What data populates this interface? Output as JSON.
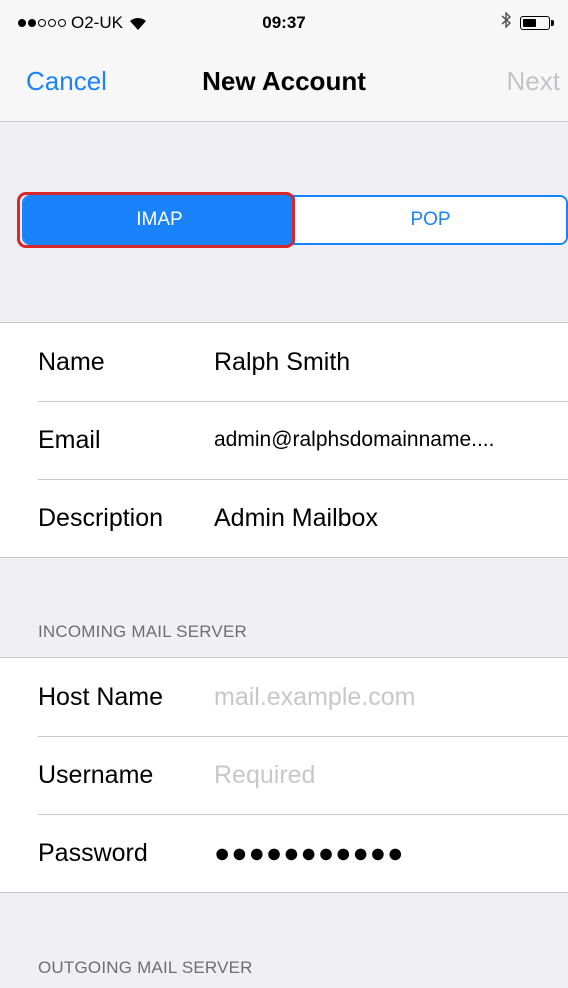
{
  "status_bar": {
    "carrier": "O2-UK",
    "signal_bars_filled": 2,
    "signal_bars_total": 5,
    "time": "09:37",
    "battery_level": 0.55,
    "icons": [
      "wifi-icon",
      "bluetooth-icon",
      "battery-icon"
    ]
  },
  "nav": {
    "cancel_label": "Cancel",
    "title": "New Account",
    "next_label": "Next"
  },
  "account_type": {
    "options": [
      "IMAP",
      "POP"
    ],
    "selected": "IMAP"
  },
  "account_info": {
    "name": {
      "label": "Name",
      "value": "Ralph Smith"
    },
    "email": {
      "label": "Email",
      "value": "admin@ralphsdomainname...."
    },
    "description": {
      "label": "Description",
      "value": "Admin Mailbox"
    }
  },
  "incoming": {
    "header": "INCOMING MAIL SERVER",
    "host": {
      "label": "Host Name",
      "placeholder": "mail.example.com"
    },
    "username": {
      "label": "Username",
      "placeholder": "Required"
    },
    "password": {
      "label": "Password",
      "value": "●●●●●●●●●●●"
    }
  },
  "outgoing": {
    "header": "OUTGOING MAIL SERVER"
  },
  "colors": {
    "accent": "#1a82fb",
    "highlight": "#d8262a",
    "placeholder": "#c7c7cd",
    "disabled": "#c4c4c7"
  }
}
